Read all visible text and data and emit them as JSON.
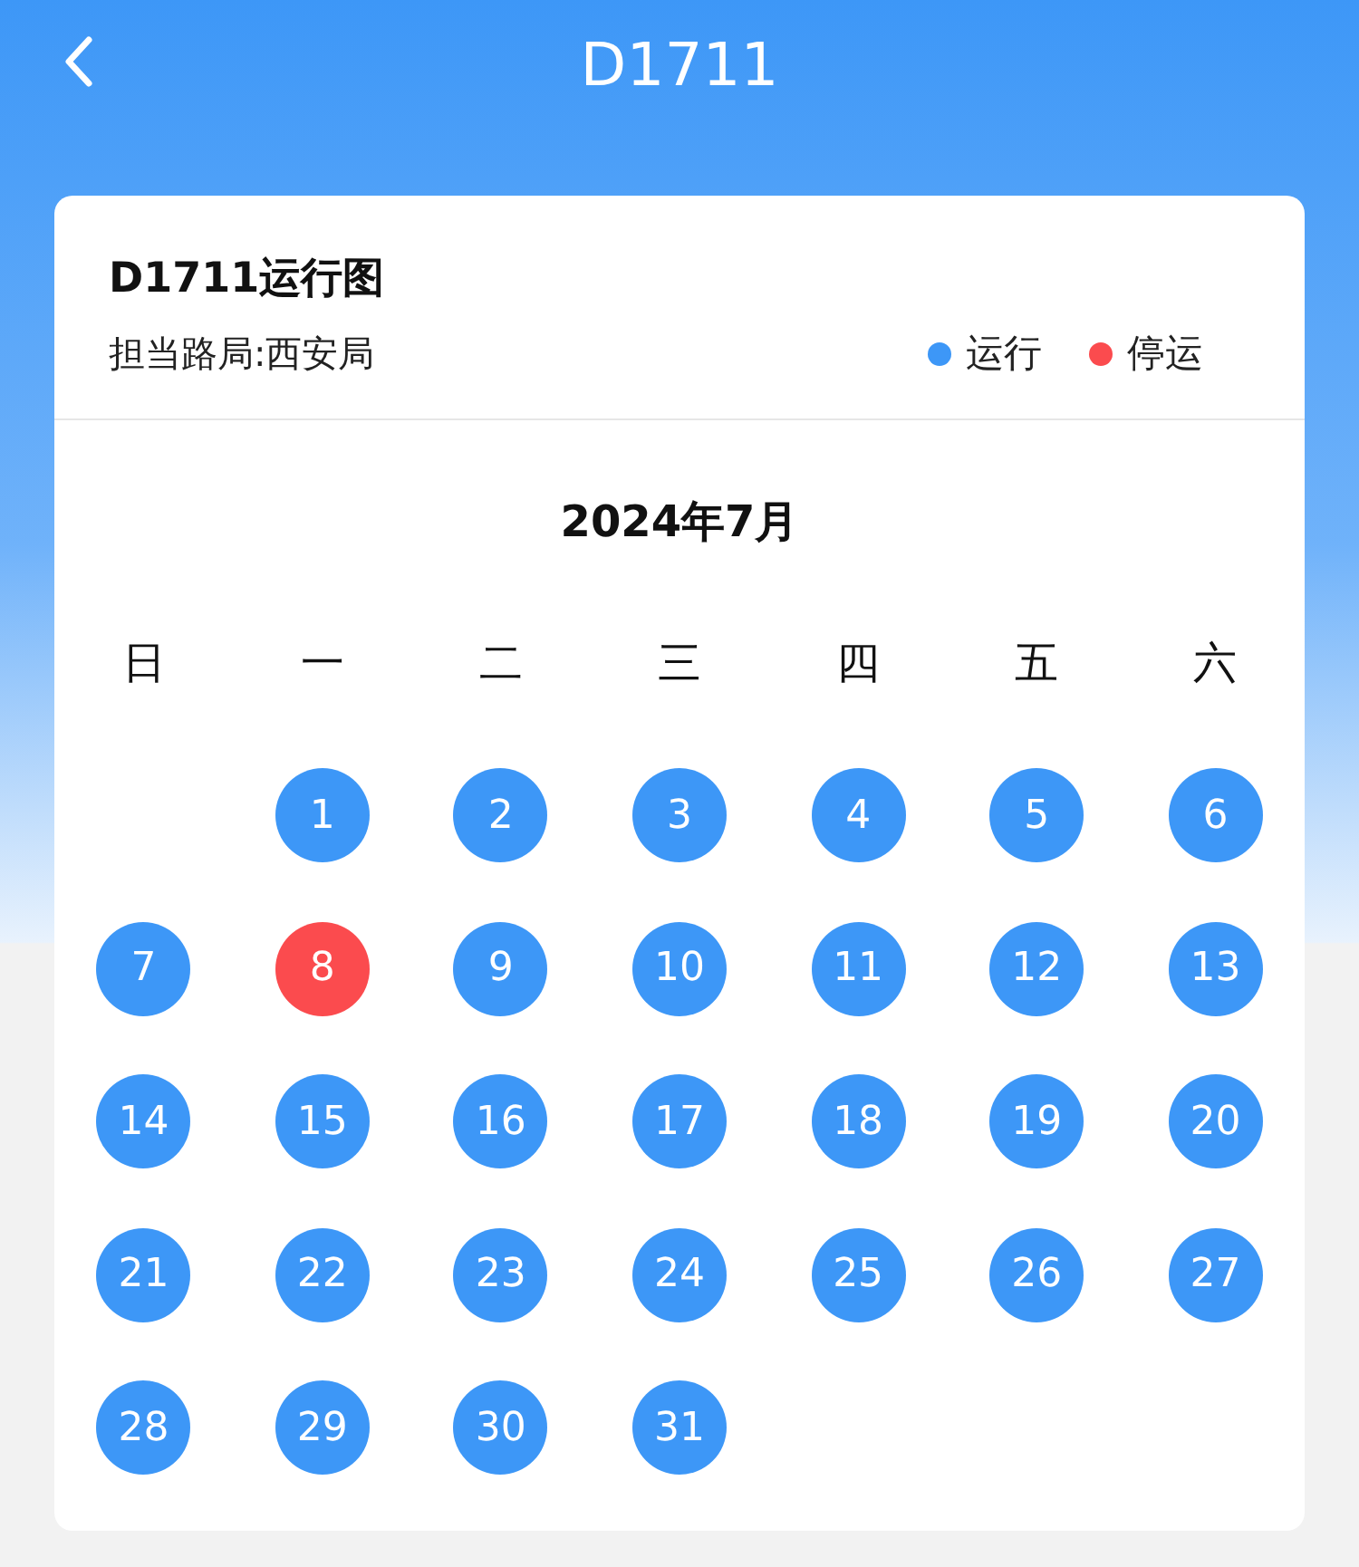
{
  "header": {
    "title": "D1711"
  },
  "card": {
    "title": "D1711运行图",
    "subtitle": "担当路局:西安局",
    "legend": [
      {
        "label": "运行",
        "color": "#3d97f7"
      },
      {
        "label": "停运",
        "color": "#fb4b4e"
      }
    ]
  },
  "calendar": {
    "month": "2024年7月",
    "weekdays": [
      "日",
      "一",
      "二",
      "三",
      "四",
      "五",
      "六"
    ],
    "weeks": [
      [
        {
          "kind": "empty"
        },
        {
          "kind": "day",
          "day": "1",
          "color": "#3d97f7"
        },
        {
          "kind": "day",
          "day": "2",
          "color": "#3d97f7"
        },
        {
          "kind": "day",
          "day": "3",
          "color": "#3d97f7"
        },
        {
          "kind": "day",
          "day": "4",
          "color": "#3d97f7"
        },
        {
          "kind": "day",
          "day": "5",
          "color": "#3d97f7"
        },
        {
          "kind": "day",
          "day": "6",
          "color": "#3d97f7"
        }
      ],
      [
        {
          "kind": "day",
          "day": "7",
          "color": "#3d97f7"
        },
        {
          "kind": "day",
          "day": "8",
          "color": "#fb4b4e"
        },
        {
          "kind": "day",
          "day": "9",
          "color": "#3d97f7"
        },
        {
          "kind": "day",
          "day": "10",
          "color": "#3d97f7"
        },
        {
          "kind": "day",
          "day": "11",
          "color": "#3d97f7"
        },
        {
          "kind": "day",
          "day": "12",
          "color": "#3d97f7"
        },
        {
          "kind": "day",
          "day": "13",
          "color": "#3d97f7"
        }
      ],
      [
        {
          "kind": "day",
          "day": "14",
          "color": "#3d97f7"
        },
        {
          "kind": "day",
          "day": "15",
          "color": "#3d97f7"
        },
        {
          "kind": "day",
          "day": "16",
          "color": "#3d97f7"
        },
        {
          "kind": "day",
          "day": "17",
          "color": "#3d97f7"
        },
        {
          "kind": "day",
          "day": "18",
          "color": "#3d97f7"
        },
        {
          "kind": "day",
          "day": "19",
          "color": "#3d97f7"
        },
        {
          "kind": "day",
          "day": "20",
          "color": "#3d97f7"
        }
      ],
      [
        {
          "kind": "day",
          "day": "21",
          "color": "#3d97f7"
        },
        {
          "kind": "day",
          "day": "22",
          "color": "#3d97f7"
        },
        {
          "kind": "day",
          "day": "23",
          "color": "#3d97f7"
        },
        {
          "kind": "day",
          "day": "24",
          "color": "#3d97f7"
        },
        {
          "kind": "day",
          "day": "25",
          "color": "#3d97f7"
        },
        {
          "kind": "day",
          "day": "26",
          "color": "#3d97f7"
        },
        {
          "kind": "day",
          "day": "27",
          "color": "#3d97f7"
        }
      ],
      [
        {
          "kind": "day",
          "day": "28",
          "color": "#3d97f7"
        },
        {
          "kind": "day",
          "day": "29",
          "color": "#3d97f7"
        },
        {
          "kind": "day",
          "day": "30",
          "color": "#3d97f7"
        },
        {
          "kind": "day",
          "day": "31",
          "color": "#3d97f7"
        },
        {
          "kind": "empty"
        },
        {
          "kind": "empty"
        },
        {
          "kind": "empty"
        }
      ]
    ]
  }
}
